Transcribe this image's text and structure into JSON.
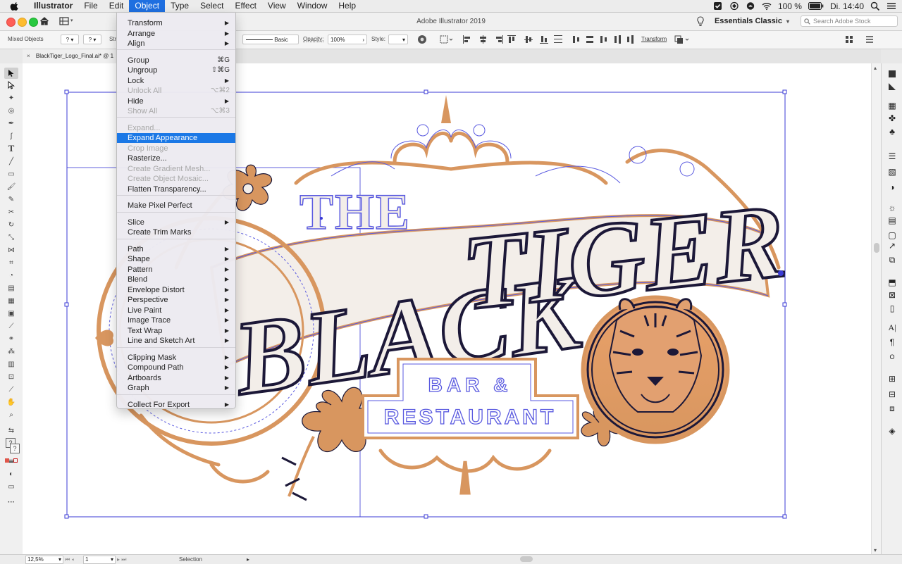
{
  "menubar": {
    "app_name": "Illustrator",
    "items": [
      "File",
      "Edit",
      "Object",
      "Type",
      "Select",
      "Effect",
      "View",
      "Window",
      "Help"
    ],
    "active_item": "Object",
    "battery": "100 %",
    "clock": "Di. 14:40"
  },
  "app": {
    "window_title": "Adobe Illustrator 2019",
    "workspace": "Essentials Classic",
    "stock_search_placeholder": "Search Adobe Stock"
  },
  "control_bar": {
    "selection_type": "Mixed Objects",
    "stroke_label": "Str",
    "brush": "Basic",
    "opacity_label": "Opacity:",
    "opacity_value": "100%",
    "style_label": "Style:",
    "transform_label": "Transform"
  },
  "document": {
    "tab_label": "BlackTiger_Logo_Final.ai* @ 1"
  },
  "status_bar": {
    "zoom": "12,5%",
    "artboard": "1",
    "tool": "Selection"
  },
  "object_menu": {
    "items": [
      {
        "label": "Transform",
        "shortcut": "",
        "submenu": true,
        "disabled": false
      },
      {
        "label": "Arrange",
        "shortcut": "",
        "submenu": true,
        "disabled": false
      },
      {
        "label": "Align",
        "shortcut": "",
        "submenu": true,
        "disabled": false
      },
      {
        "label": "Group",
        "shortcut": "⌘G",
        "submenu": false,
        "disabled": false
      },
      {
        "label": "Ungroup",
        "shortcut": "⇧⌘G",
        "submenu": false,
        "disabled": false
      },
      {
        "label": "Lock",
        "shortcut": "",
        "submenu": true,
        "disabled": false
      },
      {
        "label": "Unlock All",
        "shortcut": "⌥⌘2",
        "submenu": false,
        "disabled": true
      },
      {
        "label": "Hide",
        "shortcut": "",
        "submenu": true,
        "disabled": false
      },
      {
        "label": "Show All",
        "shortcut": "⌥⌘3",
        "submenu": false,
        "disabled": true
      },
      {
        "label": "Expand...",
        "shortcut": "",
        "submenu": false,
        "disabled": true
      },
      {
        "label": "Expand Appearance",
        "shortcut": "",
        "submenu": false,
        "disabled": false,
        "highlighted": true
      },
      {
        "label": "Crop Image",
        "shortcut": "",
        "submenu": false,
        "disabled": true
      },
      {
        "label": "Rasterize...",
        "shortcut": "",
        "submenu": false,
        "disabled": false
      },
      {
        "label": "Create Gradient Mesh...",
        "shortcut": "",
        "submenu": false,
        "disabled": true
      },
      {
        "label": "Create Object Mosaic...",
        "shortcut": "",
        "submenu": false,
        "disabled": true
      },
      {
        "label": "Flatten Transparency...",
        "shortcut": "",
        "submenu": false,
        "disabled": false
      },
      {
        "label": "Make Pixel Perfect",
        "shortcut": "",
        "submenu": false,
        "disabled": false
      },
      {
        "label": "Slice",
        "shortcut": "",
        "submenu": true,
        "disabled": false
      },
      {
        "label": "Create Trim Marks",
        "shortcut": "",
        "submenu": false,
        "disabled": false
      },
      {
        "label": "Path",
        "shortcut": "",
        "submenu": true,
        "disabled": false
      },
      {
        "label": "Shape",
        "shortcut": "",
        "submenu": true,
        "disabled": false
      },
      {
        "label": "Pattern",
        "shortcut": "",
        "submenu": true,
        "disabled": false
      },
      {
        "label": "Blend",
        "shortcut": "",
        "submenu": true,
        "disabled": false
      },
      {
        "label": "Envelope Distort",
        "shortcut": "",
        "submenu": true,
        "disabled": false
      },
      {
        "label": "Perspective",
        "shortcut": "",
        "submenu": true,
        "disabled": false
      },
      {
        "label": "Live Paint",
        "shortcut": "",
        "submenu": true,
        "disabled": false
      },
      {
        "label": "Image Trace",
        "shortcut": "",
        "submenu": true,
        "disabled": false
      },
      {
        "label": "Text Wrap",
        "shortcut": "",
        "submenu": true,
        "disabled": false
      },
      {
        "label": "Line and Sketch Art",
        "shortcut": "",
        "submenu": true,
        "disabled": false
      },
      {
        "label": "Clipping Mask",
        "shortcut": "",
        "submenu": true,
        "disabled": false
      },
      {
        "label": "Compound Path",
        "shortcut": "",
        "submenu": true,
        "disabled": false
      },
      {
        "label": "Artboards",
        "shortcut": "",
        "submenu": true,
        "disabled": false
      },
      {
        "label": "Graph",
        "shortcut": "",
        "submenu": true,
        "disabled": false
      },
      {
        "label": "Collect For Export",
        "shortcut": "",
        "submenu": true,
        "disabled": false
      }
    ]
  },
  "artwork": {
    "word_the": "THE",
    "word_black": "BLACK",
    "word_tiger": "TIGER",
    "line_bar": "BAR &",
    "line_restaurant": "RESTAURANT"
  },
  "colors": {
    "accent_blue": "#1b78e6",
    "selection_blue": "#3b3bd6",
    "ornament_orange": "#d8965f",
    "banner_cream": "#f3eee9",
    "ink_dark": "#1c1838"
  }
}
